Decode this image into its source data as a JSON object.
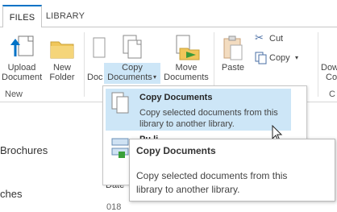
{
  "tabs": [
    {
      "label": "FILES"
    },
    {
      "label": "LIBRARY"
    }
  ],
  "ribbon": {
    "upload_label_1": "Upload",
    "upload_label_2": "Document",
    "new_label_1": "New",
    "new_label_2": "Folder",
    "group_new": "New",
    "doc_partial": "Doc",
    "copy_docs_1": "Copy",
    "copy_docs_2": "Documents",
    "move_docs_1": "Move",
    "move_docs_2": "Documents",
    "paste_label": "Paste",
    "cut_label": "Cut",
    "copy_label": "Copy",
    "download_1": "Downl",
    "download_2": "Co",
    "group_c_partial": "C"
  },
  "menu": {
    "item1_title": "Copy Documents",
    "item1_desc_1": "Copy selected documents from this",
    "item1_desc_2": "library to another library.",
    "item2_title_partial": "Pu li..."
  },
  "tooltip": {
    "title": "Copy Documents",
    "desc_1": "Copy selected documents from this",
    "desc_2": "library to another library."
  },
  "list": {
    "brochures": "Brochures",
    "ches": "ches",
    "date_header": "Date",
    "year_partial": "018"
  },
  "colors": {
    "accent": "#0072c6",
    "highlight": "#cde6f7",
    "folder": "#f0c65a"
  }
}
